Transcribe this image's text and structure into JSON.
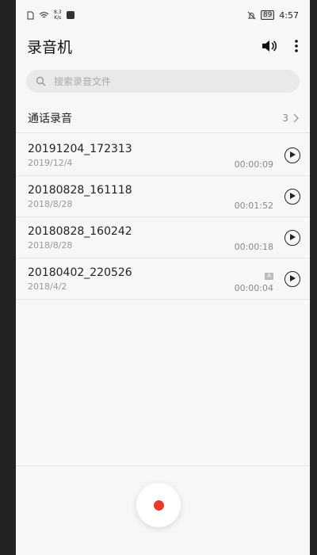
{
  "status_bar": {
    "speed_value": "8.3",
    "speed_unit": "K/s",
    "battery": "89",
    "time": "4:57"
  },
  "header": {
    "title": "录音机"
  },
  "search": {
    "placeholder": "搜索录音文件"
  },
  "section": {
    "label": "通话录音",
    "count": "3"
  },
  "recordings": [
    {
      "name": "20191204_172313",
      "date": "2019/12/4",
      "duration": "00:00:09",
      "badge": ""
    },
    {
      "name": "20180828_161118",
      "date": "2018/8/28",
      "duration": "00:01:52",
      "badge": ""
    },
    {
      "name": "20180828_160242",
      "date": "2018/8/28",
      "duration": "00:00:18",
      "badge": ""
    },
    {
      "name": "20180402_220526",
      "date": "2018/4/2",
      "duration": "00:00:04",
      "badge": "A"
    }
  ],
  "colors": {
    "record_dot": "#e63a2b",
    "background": "#f7f7f7"
  }
}
